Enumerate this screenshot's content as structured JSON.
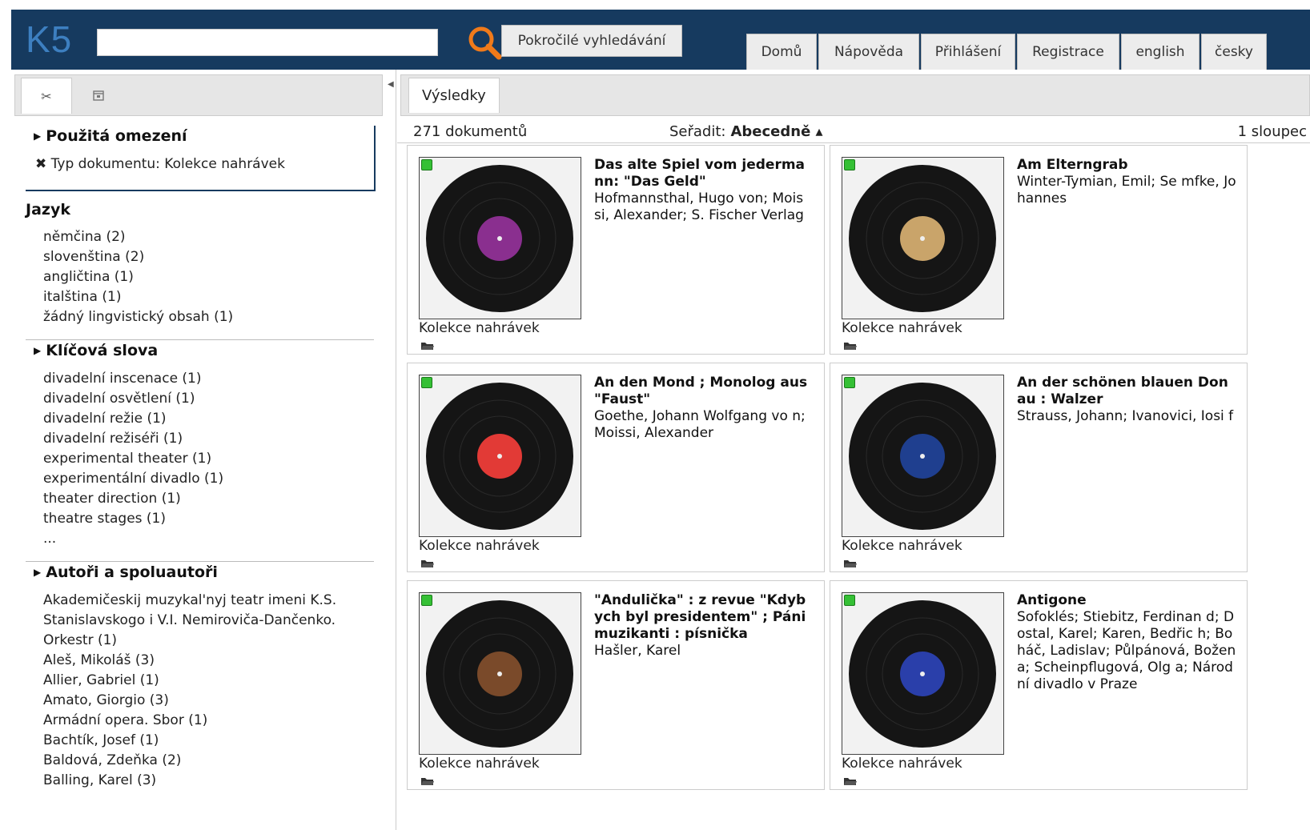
{
  "header": {
    "logo": "K5",
    "search_placeholder": "",
    "advanced_label": "Pokročilé vyhledávání",
    "nav": [
      "Domů",
      "Nápověda",
      "Přihlášení",
      "Registrace",
      "english",
      "česky"
    ]
  },
  "left": {
    "applied_title": "Použitá omezení",
    "applied_item": "✖ Typ dokumentu: Kolekce nahrávek",
    "lang_title": "Jazyk",
    "languages": [
      "němčina (2)",
      "slovenština (2)",
      "angličtina (1)",
      "italština (1)",
      "žádný lingvistický obsah (1)"
    ],
    "keywords_title": "Klíčová slova",
    "keywords": [
      "divadelní inscenace (1)",
      "divadelní osvětlení (1)",
      "divadelní režie (1)",
      "divadelní režiséři (1)",
      "experimental theater (1)",
      "experimentální divadlo (1)",
      "theater direction (1)",
      "theatre stages (1)",
      "..."
    ],
    "authors_title": "Autoři a spoluautoři",
    "authors": [
      "Akademičeskij muzykal'nyj teatr imeni K.S.",
      "Stanislavskogo i V.I. Nemiroviča-Dančenko.",
      "Orkestr (1)",
      "Aleš, Mikoláš (3)",
      "Allier, Gabriel (1)",
      "Amato, Giorgio (3)",
      "Armádní opera. Sbor (1)",
      "Bachtík, Josef (1)",
      "Baldová, Zdeňka (2)",
      "Balling, Karel (3)"
    ]
  },
  "results": {
    "tab_label": "Výsledky",
    "count": "271 dokumentů",
    "sort_label": "Seřadit:",
    "sort_value": "Abecedně ▴",
    "columns": "1 sloupec",
    "collection_label": "Kolekce nahrávek",
    "items": [
      {
        "title": "Das alte Spiel vom jederma nn: \"Das Geld\"",
        "authors": "Hofmannsthal, Hugo von; Mois si, Alexander; S. Fischer Verlag",
        "label_color": "#8a2f8f"
      },
      {
        "title": "Am Elterngrab",
        "authors": "Winter-Tymian, Emil; Se mfke, Johannes",
        "label_color": "#c9a46a"
      },
      {
        "title": "An den Mond ; Monolog aus \"Faust\"",
        "authors": "Goethe, Johann Wolfgang vo n; Moissi, Alexander",
        "label_color": "#e23a36"
      },
      {
        "title": "An der schönen blauen Don au : Walzer",
        "authors": "Strauss, Johann; Ivanovici, Iosi f",
        "label_color": "#1f3f8f"
      },
      {
        "title": "\"Andulička\" : z revue \"Kdyb ych byl presidentem\" ; Páni muzikanti : písnička",
        "authors": "Hašler, Karel",
        "label_color": "#7a4a2a"
      },
      {
        "title": "Antigone",
        "authors": "Sofoklés; Stiebitz, Ferdinan d; Dostal, Karel; Karen, Bedřic h; Boháč, Ladislav; Půlpánová, Božena; Scheinpflugová, Olg a; Národní divadlo v Praze",
        "label_color": "#2a3faa"
      }
    ]
  }
}
